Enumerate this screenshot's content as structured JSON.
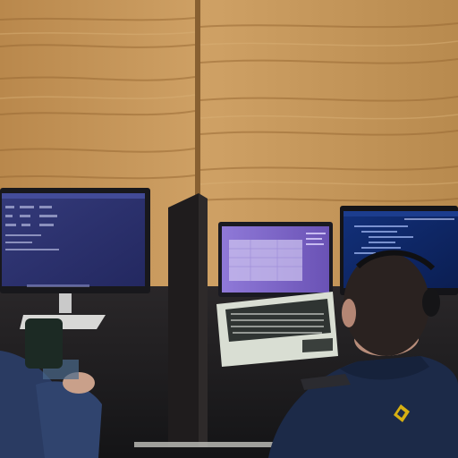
{
  "scene": {
    "description_visible_text": [],
    "colors": {
      "wood_light": "#c89a5c",
      "wood_dark": "#8d6233",
      "desk": "#222022",
      "monitor_bezel": "#1b1b1f",
      "screen_left": "#2b2f6a",
      "screen_laptop": "#7a62c6",
      "screen_right": "#0f2a6a",
      "laptop_body": "#d9ded3",
      "shirt": "#1d2b4a",
      "badge": "#d7b012"
    }
  }
}
